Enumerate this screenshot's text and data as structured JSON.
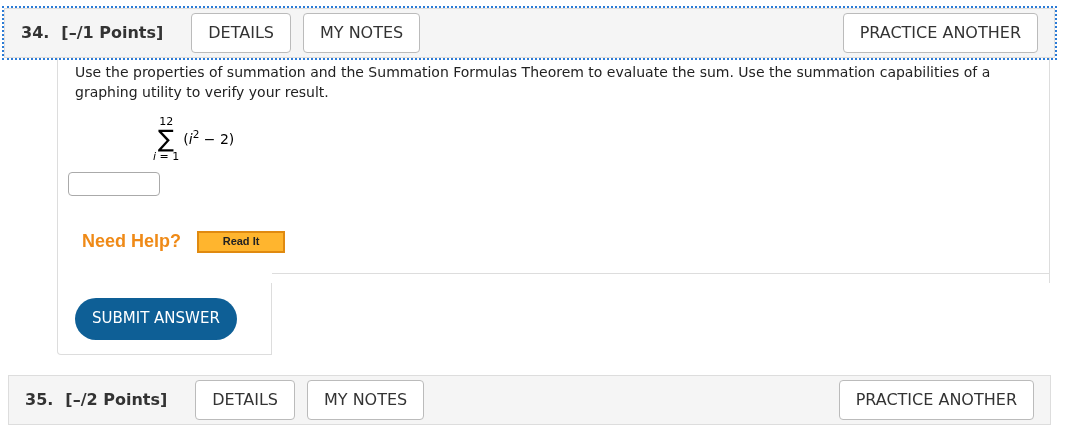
{
  "questions": [
    {
      "number": "34.",
      "points": "[–/1 Points]",
      "focused": true,
      "buttons": [
        {
          "label": "DETAILS"
        },
        {
          "label": "MY NOTES"
        }
      ],
      "practice": "PRACTICE ANOTHER",
      "prompt": "Use the properties of summation and the Summation Formulas Theorem to evaluate the sum. Use the summation capabilities of a graphing utility to verify your result.",
      "sum": {
        "upper": "12",
        "sigma": "∑",
        "term": "(*i*$^{2}$ − 2)",
        "lower": "*i* = 1"
      },
      "help": {
        "label": "Need Help?",
        "button": "Read It"
      },
      "submit": "SUBMIT ANSWER"
    },
    {
      "number": "35.",
      "points": "[–/2 Points]",
      "focused": false,
      "buttons": [
        {
          "label": "DETAILS"
        },
        {
          "label": "MY NOTES"
        }
      ],
      "practice": "PRACTICE ANOTHER"
    }
  ]
}
